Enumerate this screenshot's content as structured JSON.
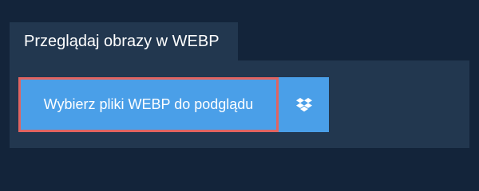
{
  "tab": {
    "label": "Przeglądaj obrazy w WEBP"
  },
  "toolbar": {
    "select_files_label": "Wybierz pliki WEBP do podglądu",
    "dropbox_icon": "dropbox-icon"
  },
  "colors": {
    "background": "#13243a",
    "panel": "#22374f",
    "button": "#4a9fe8",
    "focus_outline": "#e06461",
    "text": "#ffffff"
  }
}
